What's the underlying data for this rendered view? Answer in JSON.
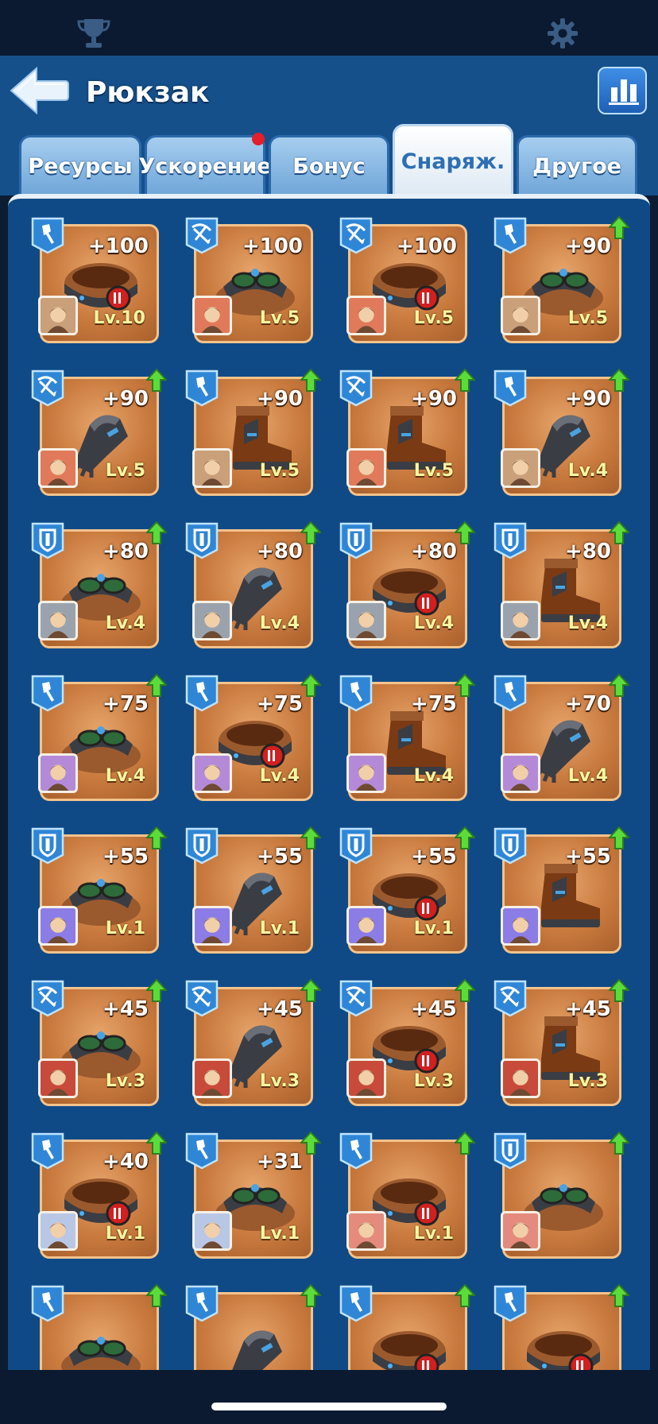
{
  "top_bar": {
    "left_icon": "trophy-icon",
    "right_icon": "gear-icon"
  },
  "header": {
    "title": "Рюкзак",
    "back_icon": "back-arrow-icon",
    "stats_icon": "bar-chart-icon"
  },
  "tabs": [
    {
      "label": "Ресурсы",
      "active": false,
      "notification": false
    },
    {
      "label": "Ускорение",
      "active": false,
      "notification": true
    },
    {
      "label": "Бонус",
      "active": false,
      "notification": false
    },
    {
      "label": "Снаряж.",
      "active": true,
      "notification": false
    },
    {
      "label": "Другое",
      "active": false,
      "notification": false
    }
  ],
  "colors": {
    "tab_active_text": "#2d6fb5",
    "notification_dot": "#e21f2b",
    "level_text": "#f6f6a0",
    "upgrade_arrow": "#5bdc3a",
    "hero_bg": {
      "blonde": "#c9a07a",
      "red": "#e07a5a",
      "helmet": "#9aa3ad",
      "clown": "#b48ad8",
      "knight": "#8c7ce6",
      "cowboy": "#c84a3a",
      "white": "#b9c7e6",
      "pink": "#e48b7d"
    }
  },
  "items": [
    {
      "class": "shovel",
      "gear": "belt",
      "value": "+100",
      "hero": "blonde",
      "level": "Lv.10",
      "upgrade": false
    },
    {
      "class": "crossbow",
      "gear": "goggles",
      "value": "+100",
      "hero": "red",
      "level": "Lv.5",
      "upgrade": false
    },
    {
      "class": "crossbow",
      "gear": "belt",
      "value": "+100",
      "hero": "red",
      "level": "Lv.5",
      "upgrade": false
    },
    {
      "class": "shovel",
      "gear": "goggles",
      "value": "+90",
      "hero": "blonde",
      "level": "Lv.5",
      "upgrade": true
    },
    {
      "class": "crossbow",
      "gear": "gauntlet",
      "value": "+90",
      "hero": "red",
      "level": "Lv.5",
      "upgrade": true
    },
    {
      "class": "shovel",
      "gear": "boot",
      "value": "+90",
      "hero": "blonde",
      "level": "Lv.5",
      "upgrade": true
    },
    {
      "class": "crossbow",
      "gear": "boot",
      "value": "+90",
      "hero": "red",
      "level": "Lv.5",
      "upgrade": true
    },
    {
      "class": "shovel",
      "gear": "gauntlet",
      "value": "+90",
      "hero": "blonde",
      "level": "Lv.4",
      "upgrade": true
    },
    {
      "class": "shield",
      "gear": "goggles",
      "value": "+80",
      "hero": "helmet",
      "level": "Lv.4",
      "upgrade": true
    },
    {
      "class": "shield",
      "gear": "gauntlet",
      "value": "+80",
      "hero": "helmet",
      "level": "Lv.4",
      "upgrade": true
    },
    {
      "class": "shield",
      "gear": "belt",
      "value": "+80",
      "hero": "helmet",
      "level": "Lv.4",
      "upgrade": true
    },
    {
      "class": "shield",
      "gear": "boot",
      "value": "+80",
      "hero": "helmet",
      "level": "Lv.4",
      "upgrade": true
    },
    {
      "class": "shovel",
      "gear": "goggles",
      "value": "+75",
      "hero": "clown",
      "level": "Lv.4",
      "upgrade": true
    },
    {
      "class": "shovel",
      "gear": "belt",
      "value": "+75",
      "hero": "clown",
      "level": "Lv.4",
      "upgrade": true
    },
    {
      "class": "shovel",
      "gear": "boot",
      "value": "+75",
      "hero": "clown",
      "level": "Lv.4",
      "upgrade": true
    },
    {
      "class": "shovel",
      "gear": "gauntlet",
      "value": "+70",
      "hero": "clown",
      "level": "Lv.4",
      "upgrade": true
    },
    {
      "class": "shield",
      "gear": "goggles",
      "value": "+55",
      "hero": "knight",
      "level": "Lv.1",
      "upgrade": true
    },
    {
      "class": "shield",
      "gear": "gauntlet",
      "value": "+55",
      "hero": "knight",
      "level": "Lv.1",
      "upgrade": true
    },
    {
      "class": "shield",
      "gear": "belt",
      "value": "+55",
      "hero": "knight",
      "level": "Lv.1",
      "upgrade": true
    },
    {
      "class": "shield",
      "gear": "boot",
      "value": "+55",
      "hero": "knight",
      "level": "",
      "upgrade": true
    },
    {
      "class": "crossbow",
      "gear": "goggles",
      "value": "+45",
      "hero": "cowboy",
      "level": "Lv.3",
      "upgrade": true
    },
    {
      "class": "crossbow",
      "gear": "gauntlet",
      "value": "+45",
      "hero": "cowboy",
      "level": "Lv.3",
      "upgrade": true
    },
    {
      "class": "crossbow",
      "gear": "belt",
      "value": "+45",
      "hero": "cowboy",
      "level": "Lv.3",
      "upgrade": true
    },
    {
      "class": "crossbow",
      "gear": "boot",
      "value": "+45",
      "hero": "cowboy",
      "level": "Lv.3",
      "upgrade": true
    },
    {
      "class": "shovel",
      "gear": "belt",
      "value": "+40",
      "hero": "white",
      "level": "Lv.1",
      "upgrade": true
    },
    {
      "class": "shovel",
      "gear": "goggles",
      "value": "+31",
      "hero": "white",
      "level": "Lv.1",
      "upgrade": true
    },
    {
      "class": "shovel",
      "gear": "belt",
      "value": "",
      "hero": "pink",
      "level": "Lv.1",
      "upgrade": true
    },
    {
      "class": "shield",
      "gear": "goggles",
      "value": "",
      "hero": "pink",
      "level": "",
      "upgrade": true
    },
    {
      "class": "shovel",
      "gear": "goggles",
      "value": "",
      "hero": "",
      "level": "",
      "upgrade": true
    },
    {
      "class": "shovel",
      "gear": "gauntlet",
      "value": "",
      "hero": "",
      "level": "",
      "upgrade": true
    },
    {
      "class": "shovel",
      "gear": "belt",
      "value": "",
      "hero": "",
      "level": "",
      "upgrade": true
    },
    {
      "class": "shovel",
      "gear": "belt",
      "value": "",
      "hero": "",
      "level": "",
      "upgrade": true
    }
  ]
}
